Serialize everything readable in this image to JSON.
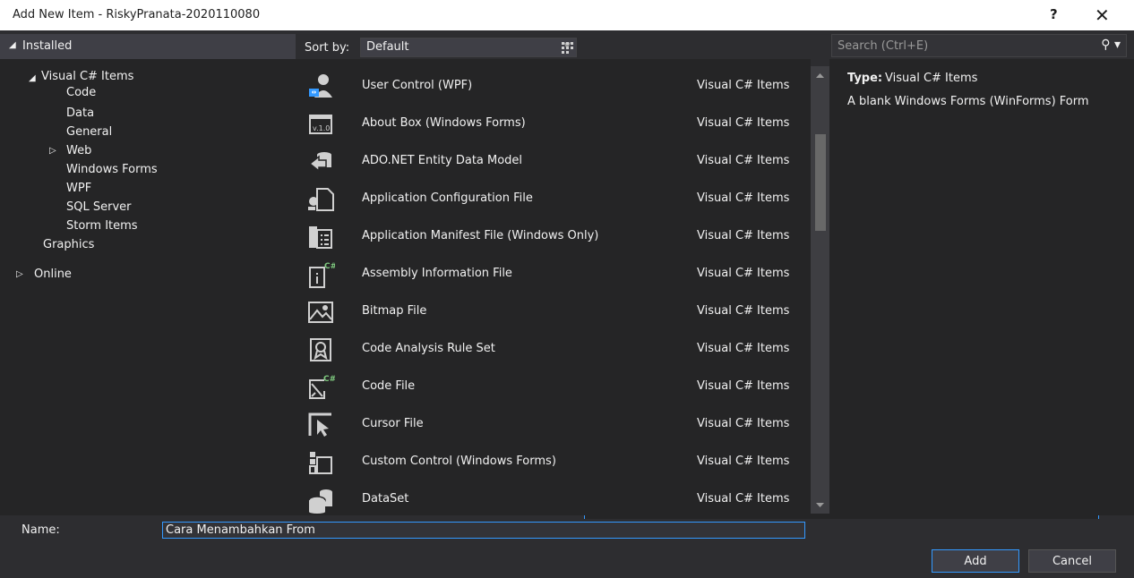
{
  "window": {
    "title": "Add New Item - RiskyPranata-2020110080",
    "help_glyph": "?",
    "close_glyph": "✕"
  },
  "left_header": {
    "label": "Installed"
  },
  "sort": {
    "label": "Sort by:",
    "value": "Default"
  },
  "search": {
    "placeholder": "Search (Ctrl+E)"
  },
  "tree": {
    "root": "Visual C# Items",
    "children": [
      "Code",
      "Data",
      "General",
      "Web",
      "Windows Forms",
      "WPF",
      "SQL Server",
      "Storm Items"
    ],
    "graphics": "Graphics",
    "online": "Online"
  },
  "items": [
    {
      "name": "User Control (WPF)",
      "category": "Visual C# Items",
      "icon": "user-control-icon"
    },
    {
      "name": "About Box (Windows Forms)",
      "category": "Visual C# Items",
      "icon": "about-box-icon"
    },
    {
      "name": "ADO.NET Entity Data Model",
      "category": "Visual C# Items",
      "icon": "entity-model-icon"
    },
    {
      "name": "Application Configuration File",
      "category": "Visual C# Items",
      "icon": "config-file-icon"
    },
    {
      "name": "Application Manifest File (Windows Only)",
      "category": "Visual C# Items",
      "icon": "manifest-file-icon"
    },
    {
      "name": "Assembly Information File",
      "category": "Visual C# Items",
      "icon": "assembly-info-icon"
    },
    {
      "name": "Bitmap File",
      "category": "Visual C# Items",
      "icon": "bitmap-icon"
    },
    {
      "name": "Code Analysis Rule Set",
      "category": "Visual C# Items",
      "icon": "rule-set-icon"
    },
    {
      "name": "Code File",
      "category": "Visual C# Items",
      "icon": "code-file-icon"
    },
    {
      "name": "Cursor File",
      "category": "Visual C# Items",
      "icon": "cursor-icon"
    },
    {
      "name": "Custom Control (Windows Forms)",
      "category": "Visual C# Items",
      "icon": "custom-control-icon"
    },
    {
      "name": "DataSet",
      "category": "Visual C# Items",
      "icon": "dataset-icon"
    }
  ],
  "details": {
    "type_label": "Type:",
    "type_value": "Visual C# Items",
    "description": "A blank Windows Forms (WinForms) Form"
  },
  "form": {
    "name_label": "Name:",
    "name_value": "Cara Menambahkan From",
    "add_label": "Add",
    "cancel_label": "Cancel"
  },
  "colors": {
    "background": "#2d2d30",
    "panel": "#252526",
    "accent": "#3399ff",
    "text": "#f1f1f1"
  }
}
